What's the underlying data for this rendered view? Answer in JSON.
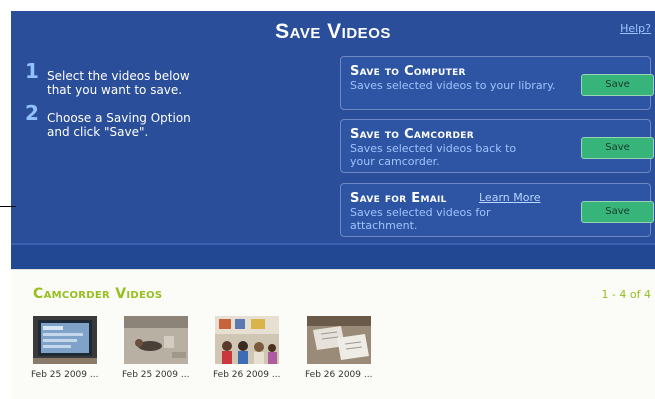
{
  "header": {
    "title": "Save Videos",
    "help": "Help?"
  },
  "steps": [
    {
      "num": "1",
      "text": "Select the videos below that you want to save."
    },
    {
      "num": "2",
      "text": "Choose a Saving Option and click \"Save\"."
    }
  ],
  "options": [
    {
      "title": "Save to Computer",
      "desc": "Saves selected videos to your library.",
      "button": "Save"
    },
    {
      "title": "Save to Camcorder",
      "desc": "Saves selected videos back to your camcorder.",
      "button": "Save"
    },
    {
      "title": "Save for Email",
      "learn_more": "Learn More",
      "desc": "Saves selected videos for attachment.",
      "button": "Save"
    }
  ],
  "videos": {
    "title": "Camcorder Videos",
    "count": "1 - 4 of 4",
    "items": [
      {
        "caption": "Feb 25 2009 ..."
      },
      {
        "caption": "Feb 25 2009 ..."
      },
      {
        "caption": "Feb 26 2009 ..."
      },
      {
        "caption": "Feb 26 2009 ..."
      }
    ]
  },
  "colors": {
    "panel": "#2a4e99",
    "accent_green": "#96bf1f",
    "button": "#36b47a"
  }
}
